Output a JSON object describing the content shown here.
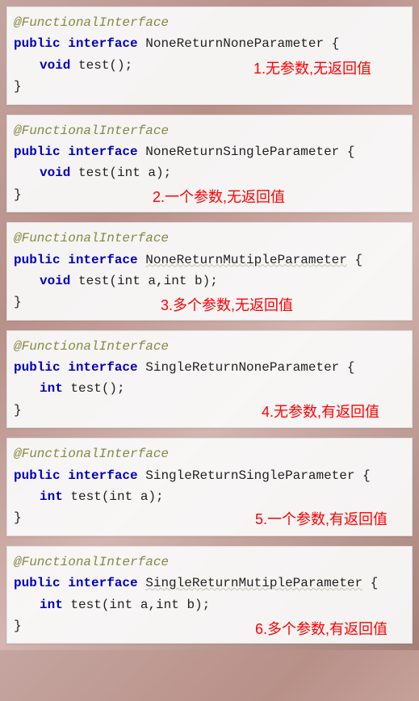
{
  "blocks": [
    {
      "annotation": "@FunctionalInterface",
      "decl_prefix": "public interface",
      "interface_name": "NoneReturnNoneParameter",
      "method_return": "void",
      "method_name": "test",
      "method_params": "()",
      "caption": "1.无参数,无返回值"
    },
    {
      "annotation": "@FunctionalInterface",
      "decl_prefix": "public interface",
      "interface_name": "NoneReturnSingleParameter",
      "method_return": "void",
      "method_name": "test",
      "method_params": "(int a)",
      "caption": "2.一个参数,无返回值"
    },
    {
      "annotation": "@FunctionalInterface",
      "decl_prefix": "public interface",
      "interface_name": "NoneReturnMutipleParameter",
      "method_return": "void",
      "method_name": "test",
      "method_params": "(int a,int b)",
      "caption": "3.多个参数,无返回值"
    },
    {
      "annotation": "@FunctionalInterface",
      "decl_prefix": "public interface",
      "interface_name": "SingleReturnNoneParameter",
      "method_return": "int",
      "method_name": "test",
      "method_params": "()",
      "caption": "4.无参数,有返回值"
    },
    {
      "annotation": "@FunctionalInterface",
      "decl_prefix": "public interface",
      "interface_name": "SingleReturnSingleParameter",
      "method_return": "int",
      "method_name": "test",
      "method_params": "(int a)",
      "caption": "5.一个参数,有返回值"
    },
    {
      "annotation": "@FunctionalInterface",
      "decl_prefix": "public interface",
      "interface_name": "SingleReturnMutipleParameter",
      "method_return": "int",
      "method_name": "test",
      "method_params": "(int a,int b)",
      "caption": "6.多个参数,有返回值"
    }
  ],
  "common": {
    "open_brace": "{",
    "close_brace": "}",
    "semicolon": ";"
  }
}
